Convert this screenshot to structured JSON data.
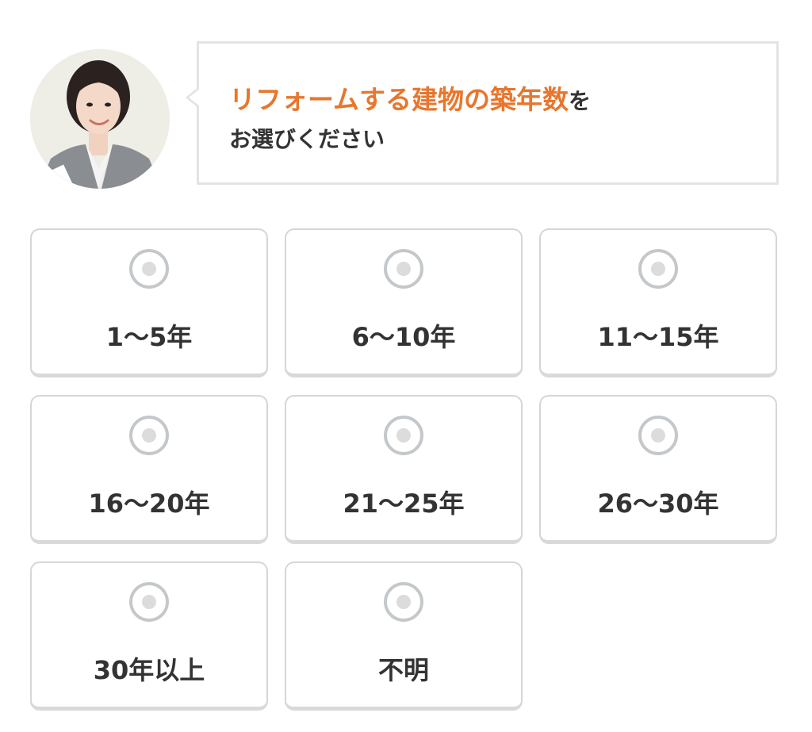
{
  "question": {
    "highlight": "リフォームする建物の築年数",
    "suffix": "を",
    "line2": "お選びください",
    "highlight_color": "#e8762d"
  },
  "avatar": {
    "icon": "operator-avatar-icon"
  },
  "options": [
    {
      "label": "1〜5年",
      "selected": false
    },
    {
      "label": "6〜10年",
      "selected": false
    },
    {
      "label": "11〜15年",
      "selected": false
    },
    {
      "label": "16〜20年",
      "selected": false
    },
    {
      "label": "21〜25年",
      "selected": false
    },
    {
      "label": "26〜30年",
      "selected": false
    },
    {
      "label": "30年以上",
      "selected": false
    },
    {
      "label": "不明",
      "selected": false
    }
  ]
}
